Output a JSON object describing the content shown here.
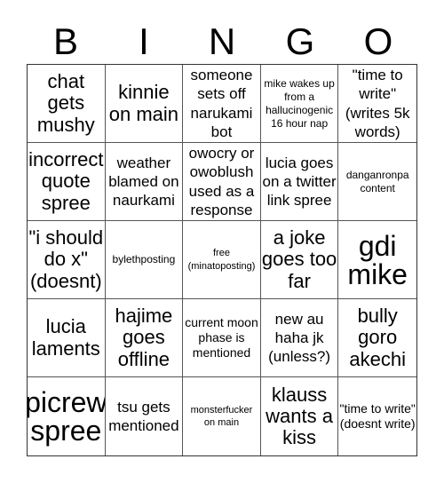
{
  "header": [
    "B",
    "I",
    "N",
    "G",
    "O"
  ],
  "cells": [
    {
      "text": "chat gets mushy",
      "size": "s-l"
    },
    {
      "text": "kinnie on main",
      "size": "s-l"
    },
    {
      "text": "someone sets off narukami bot",
      "size": "s-m"
    },
    {
      "text": "mike wakes up from a hallucinogenic 16 hour nap",
      "size": "s-xs"
    },
    {
      "text": "\"time to write\" (writes 5k words)",
      "size": "s-m"
    },
    {
      "text": "incorrect quote spree",
      "size": "s-l"
    },
    {
      "text": "weather blamed on naurkami",
      "size": "s-m"
    },
    {
      "text": "owocry or owoblush used as a response",
      "size": "s-m"
    },
    {
      "text": "lucia goes on a twitter link spree",
      "size": "s-m"
    },
    {
      "text": "danganronpa content",
      "size": "s-xs"
    },
    {
      "text": "\"i should do x\" (doesnt)",
      "size": "s-l"
    },
    {
      "text": "bylethposting",
      "size": "s-xs"
    },
    {
      "text": "free (minatoposting)",
      "size": "s-xxs"
    },
    {
      "text": "a joke goes too far",
      "size": "s-l"
    },
    {
      "text": "gdi mike",
      "size": "s-xl"
    },
    {
      "text": "lucia laments",
      "size": "s-l"
    },
    {
      "text": "hajime goes offline",
      "size": "s-l"
    },
    {
      "text": "current moon phase is mentioned",
      "size": "s-s"
    },
    {
      "text": "new au haha jk (unless?)",
      "size": "s-m"
    },
    {
      "text": "bully goro akechi",
      "size": "s-l"
    },
    {
      "text": "picrew spree",
      "size": "s-xl"
    },
    {
      "text": "tsu gets mentioned",
      "size": "s-m"
    },
    {
      "text": "monsterfucker on main",
      "size": "s-xxs"
    },
    {
      "text": "klauss wants a kiss",
      "size": "s-l"
    },
    {
      "text": "\"time to write\" (doesnt write)",
      "size": "s-s"
    }
  ]
}
